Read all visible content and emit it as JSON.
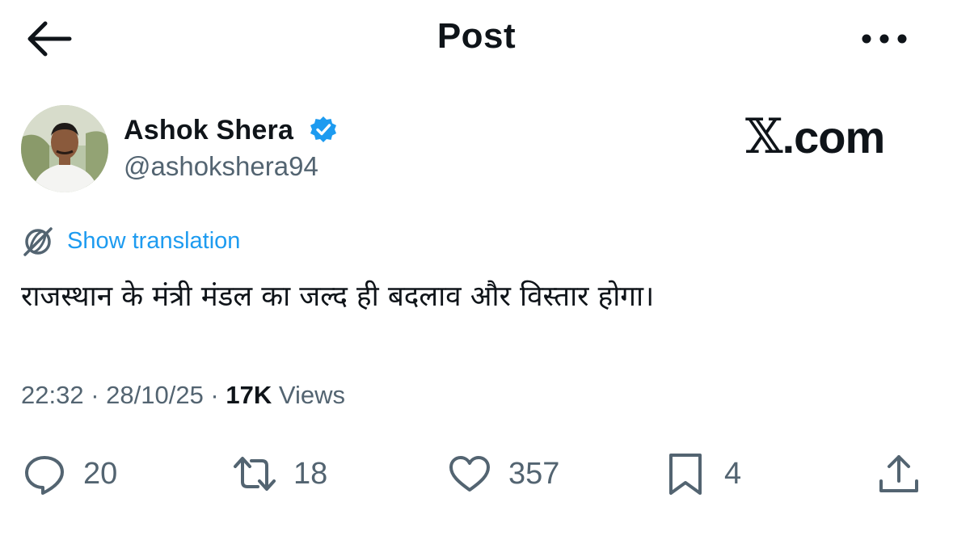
{
  "header": {
    "title": "Post"
  },
  "author": {
    "name": "Ashok Shera",
    "handle": "@ashokshera94"
  },
  "watermark": {
    "x": "𝕏",
    "domain": ".com"
  },
  "post": {
    "translate_label": "Show translation",
    "text": "राजस्थान के मंत्री मंडल का जल्द ही बदलाव और विस्तार होगा।"
  },
  "meta": {
    "time": "22:32",
    "date": "28/10/25",
    "views_count": "17K",
    "views_label": "Views"
  },
  "actions": {
    "replies": "20",
    "reposts": "18",
    "likes": "357",
    "bookmarks": "4"
  },
  "colors": {
    "text": "#0f1419",
    "secondary": "#536471",
    "link": "#1d9bf0",
    "verified": "#1d9bf0"
  },
  "icons": [
    "back-arrow-icon",
    "more-icon",
    "verified-badge-icon",
    "translate-icon",
    "reply-icon",
    "repost-icon",
    "like-icon",
    "bookmark-icon",
    "share-icon"
  ]
}
